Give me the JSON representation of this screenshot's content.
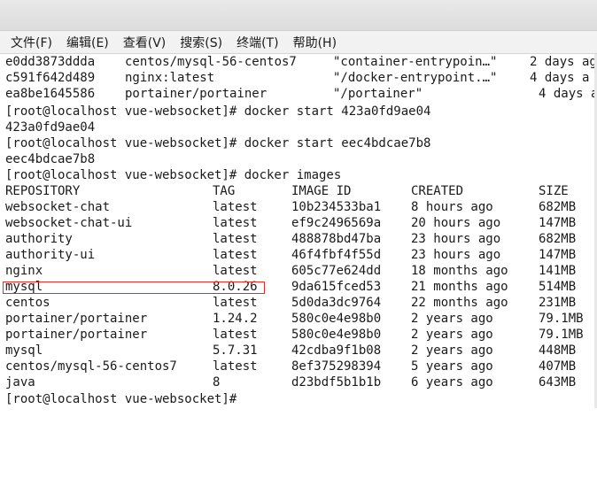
{
  "menu": [
    {
      "key": "file",
      "label": "文件(F)"
    },
    {
      "key": "edit",
      "label": "编辑(E)"
    },
    {
      "key": "view",
      "label": "查看(V)"
    },
    {
      "key": "search",
      "label": "搜索(S)"
    },
    {
      "key": "terminal",
      "label": "终端(T)"
    },
    {
      "key": "help",
      "label": "帮助(H)"
    }
  ],
  "ps_rows": [
    {
      "id": "e0dd3873ddda",
      "image": "centos/mysql-56-centos7",
      "command": "\"container-entrypoin…\"",
      "created": "2 days ag"
    },
    {
      "id": "c591f642d489",
      "image": "nginx:latest",
      "command": "\"/docker-entrypoint.…\"",
      "created": "4 days a"
    },
    {
      "id": "ea8be1645586",
      "image": "portainer/portainer",
      "command": "\"/portainer\"",
      "created": "4 days a"
    }
  ],
  "commands": [
    {
      "prompt": "[root@localhost vue-websocket]# docker start 423a0fd9ae04",
      "output": "423a0fd9ae04"
    },
    {
      "prompt": "[root@localhost vue-websocket]# docker start eec4bdcae7b8",
      "output": "eec4bdcae7b8"
    },
    {
      "prompt": "[root@localhost vue-websocket]# docker images",
      "output": ""
    }
  ],
  "images_table": {
    "headers": [
      "REPOSITORY",
      "TAG",
      "IMAGE ID",
      "CREATED",
      "SIZE"
    ],
    "rows": [
      {
        "repository": "websocket-chat",
        "tag": "latest",
        "image_id": "10b234533ba1",
        "created": "8 hours ago",
        "size": "682MB"
      },
      {
        "repository": "websocket-chat-ui",
        "tag": "latest",
        "image_id": "ef9c2496569a",
        "created": "20 hours ago",
        "size": "147MB"
      },
      {
        "repository": "authority",
        "tag": "latest",
        "image_id": "488878bd47ba",
        "created": "23 hours ago",
        "size": "682MB"
      },
      {
        "repository": "authority-ui",
        "tag": "latest",
        "image_id": "46f4fbf4f55d",
        "created": "23 hours ago",
        "size": "147MB"
      },
      {
        "repository": "nginx",
        "tag": "latest",
        "image_id": "605c77e624dd",
        "created": "18 months ago",
        "size": "141MB"
      },
      {
        "repository": "mysql",
        "tag": "8.0.26",
        "image_id": "9da615fced53",
        "created": "21 months ago",
        "size": "514MB",
        "highlighted": true
      },
      {
        "repository": "centos",
        "tag": "latest",
        "image_id": "5d0da3dc9764",
        "created": "22 months ago",
        "size": "231MB"
      },
      {
        "repository": "portainer/portainer",
        "tag": "1.24.2",
        "image_id": "580c0e4e98b0",
        "created": "2 years ago",
        "size": "79.1MB"
      },
      {
        "repository": "portainer/portainer",
        "tag": "latest",
        "image_id": "580c0e4e98b0",
        "created": "2 years ago",
        "size": "79.1MB"
      },
      {
        "repository": "mysql",
        "tag": "5.7.31",
        "image_id": "42cdba9f1b08",
        "created": "2 years ago",
        "size": "448MB"
      },
      {
        "repository": "centos/mysql-56-centos7",
        "tag": "latest",
        "image_id": "8ef375298394",
        "created": "5 years ago",
        "size": "407MB"
      },
      {
        "repository": "java",
        "tag": "8",
        "image_id": "d23bdf5b1b1b",
        "created": "6 years ago",
        "size": "643MB"
      }
    ]
  },
  "final_prompt": "[root@localhost vue-websocket]# ",
  "colors": {
    "highlight_box": "#d0342c",
    "background": "#ffffff",
    "text": "#1a1a1a"
  }
}
